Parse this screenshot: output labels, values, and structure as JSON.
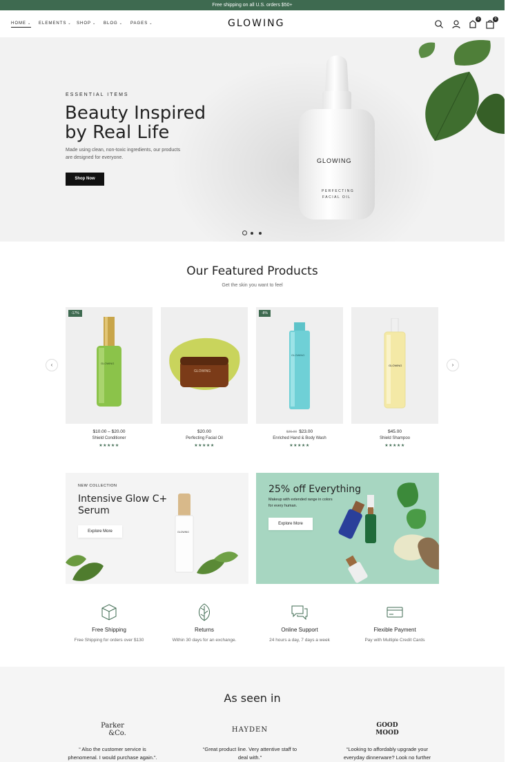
{
  "topbar": {
    "text": "Free shipping on all U.S. orders $50+"
  },
  "nav": {
    "items": [
      "HOME",
      "ELEMENTS",
      "SHOP",
      "BLOG",
      "PAGES"
    ],
    "logo": "GLOWING",
    "wishlist_count": "0",
    "cart_count": "0"
  },
  "hero": {
    "eyebrow": "ESSENTIAL ITEMS",
    "title_line1": "Beauty Inspired",
    "title_line2": "by Real Life",
    "desc": "Made using clean, non-toxic ingredients, our products are designed for everyone.",
    "cta": "Shop Now",
    "bottle_brand": "GLOWING",
    "bottle_label_line1": "PERFECTING",
    "bottle_label_line2": "FACIAL OIL",
    "slide_count": 3,
    "active_slide": 1
  },
  "featured": {
    "title": "Our Featured Products",
    "subtitle": "Get the skin you want to feel",
    "products": [
      {
        "discount": "-17%",
        "price": "$10.00 – $20.00",
        "old_price": "",
        "name": "Shield Conditioner",
        "stars": "★★★★★",
        "product_label": "GLOWING"
      },
      {
        "discount": "",
        "price": "$20.00",
        "old_price": "",
        "name": "Perfecting Facial Oil",
        "stars": "★★★★★",
        "product_label": "GLOWING"
      },
      {
        "discount": "-8%",
        "price": "$23.00",
        "old_price": "$25.00",
        "name": "Enriched Hand & Body Wash",
        "stars": "★★★★★",
        "product_label": "GLOWING"
      },
      {
        "discount": "",
        "price": "$45.00",
        "old_price": "",
        "name": "Shield Shampoo",
        "stars": "★★★★★",
        "product_label": "GLOWING"
      }
    ]
  },
  "banners": {
    "left": {
      "eyebrow": "NEW COLLECTION",
      "title_line1": "Intensive Glow C+",
      "title_line2": "Serum",
      "cta": "Explore More",
      "bottle_label": "GLOWING"
    },
    "right": {
      "title": "25% off Everything",
      "desc": "Makeup with extended range in colors for every human.",
      "cta": "Explore More"
    }
  },
  "features": [
    {
      "icon": "box-icon",
      "title": "Free Shipping",
      "desc": "Free Shipping for orders over $130"
    },
    {
      "icon": "leaf-icon",
      "title": "Returns",
      "desc": "Within 30 days for an exchange."
    },
    {
      "icon": "chat-icon",
      "title": "Online Support",
      "desc": "24 hours a day, 7 days a week"
    },
    {
      "icon": "credit-card-icon",
      "title": "Flexible Payment",
      "desc": "Pay with Multiple Credit Cards"
    }
  ],
  "seen": {
    "title": "As seen in",
    "press": [
      {
        "logo_line1": "Parker",
        "logo_line2": "&Co.",
        "quote_line1": "“ Also the customer service is",
        "quote_line2": "phenomenal. I would purchase again.”."
      },
      {
        "logo_line1": "HAYDEN",
        "logo_line2": "",
        "quote_line1": "“Great product line. Very attentive staff to",
        "quote_line2": "deal with.”"
      },
      {
        "logo_line1": "GOOD",
        "logo_line2": "MOOD",
        "quote_line1": "“Looking to affordably upgrade your",
        "quote_line2": "everyday dinnerware? Look no further"
      }
    ]
  },
  "colors": {
    "brand_green": "#3e6a50",
    "banner_mint": "#a7d6c1",
    "dark": "#111111"
  }
}
